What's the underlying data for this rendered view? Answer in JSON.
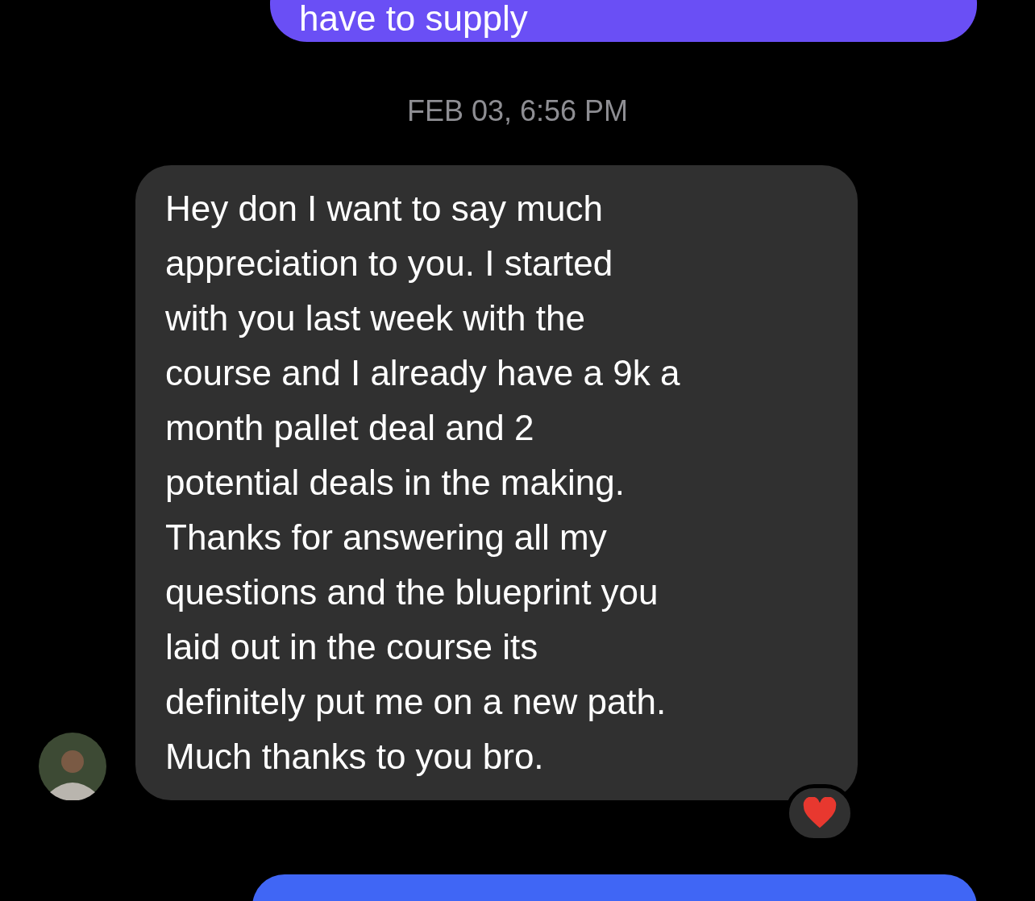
{
  "messages": [
    {
      "kind": "sent",
      "text": "have to supply",
      "color": "#6a4ff5"
    },
    {
      "kind": "timestamp",
      "text": "FEB 03, 6:56 PM"
    },
    {
      "kind": "received",
      "lines": [
        "Hey don I want to say much",
        "appreciation to you. I started",
        "with you last week with the",
        "course and I already have a 9k a",
        "month pallet deal and 2",
        "potential deals in the making.",
        "Thanks for answering all my",
        "questions and the blueprint you",
        "laid out in the course its",
        "definitely put me on a new path.",
        "Much thanks to you bro."
      ],
      "reacted": true
    },
    {
      "kind": "sent",
      "color": "#4066f5"
    }
  ]
}
